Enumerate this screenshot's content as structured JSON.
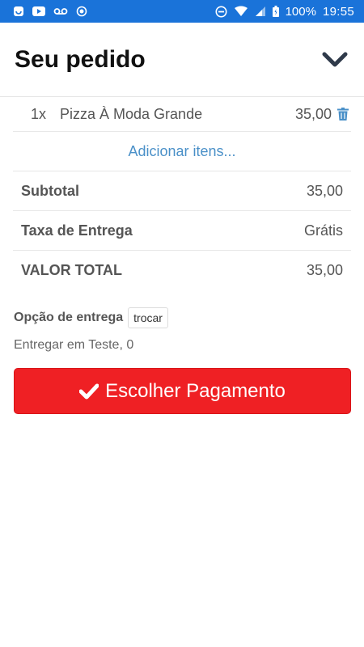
{
  "status_bar": {
    "battery_pct": "100%",
    "time": "19:55",
    "left_icons": [
      "notification-icon",
      "youtube-icon",
      "voicemail-icon",
      "record-icon"
    ],
    "right_icons": [
      "do-not-disturb-icon",
      "wifi-icon",
      "signal-icon",
      "battery-icon"
    ]
  },
  "header": {
    "title": "Seu pedido",
    "collapse_icon": "chevron-down-icon"
  },
  "order": {
    "items": [
      {
        "qty": "1x",
        "name": "Pizza À Moda Grande",
        "price": "35,00"
      }
    ],
    "add_items_label": "Adicionar itens...",
    "subtotal_label": "Subtotal",
    "subtotal_value": "35,00",
    "delivery_fee_label": "Taxa de Entrega",
    "delivery_fee_value": "Grátis",
    "total_label": "VALOR TOTAL",
    "total_value": "35,00"
  },
  "delivery": {
    "option_label": "Opção de entrega",
    "change_label": "trocar",
    "address": "Entregar em Teste, 0"
  },
  "payment": {
    "button_label": "Escolher Pagamento",
    "button_icon": "check-icon"
  },
  "colors": {
    "status_bar": "#1a73d9",
    "accent_link": "#4a90c8",
    "pay_button": "#ef2024"
  }
}
